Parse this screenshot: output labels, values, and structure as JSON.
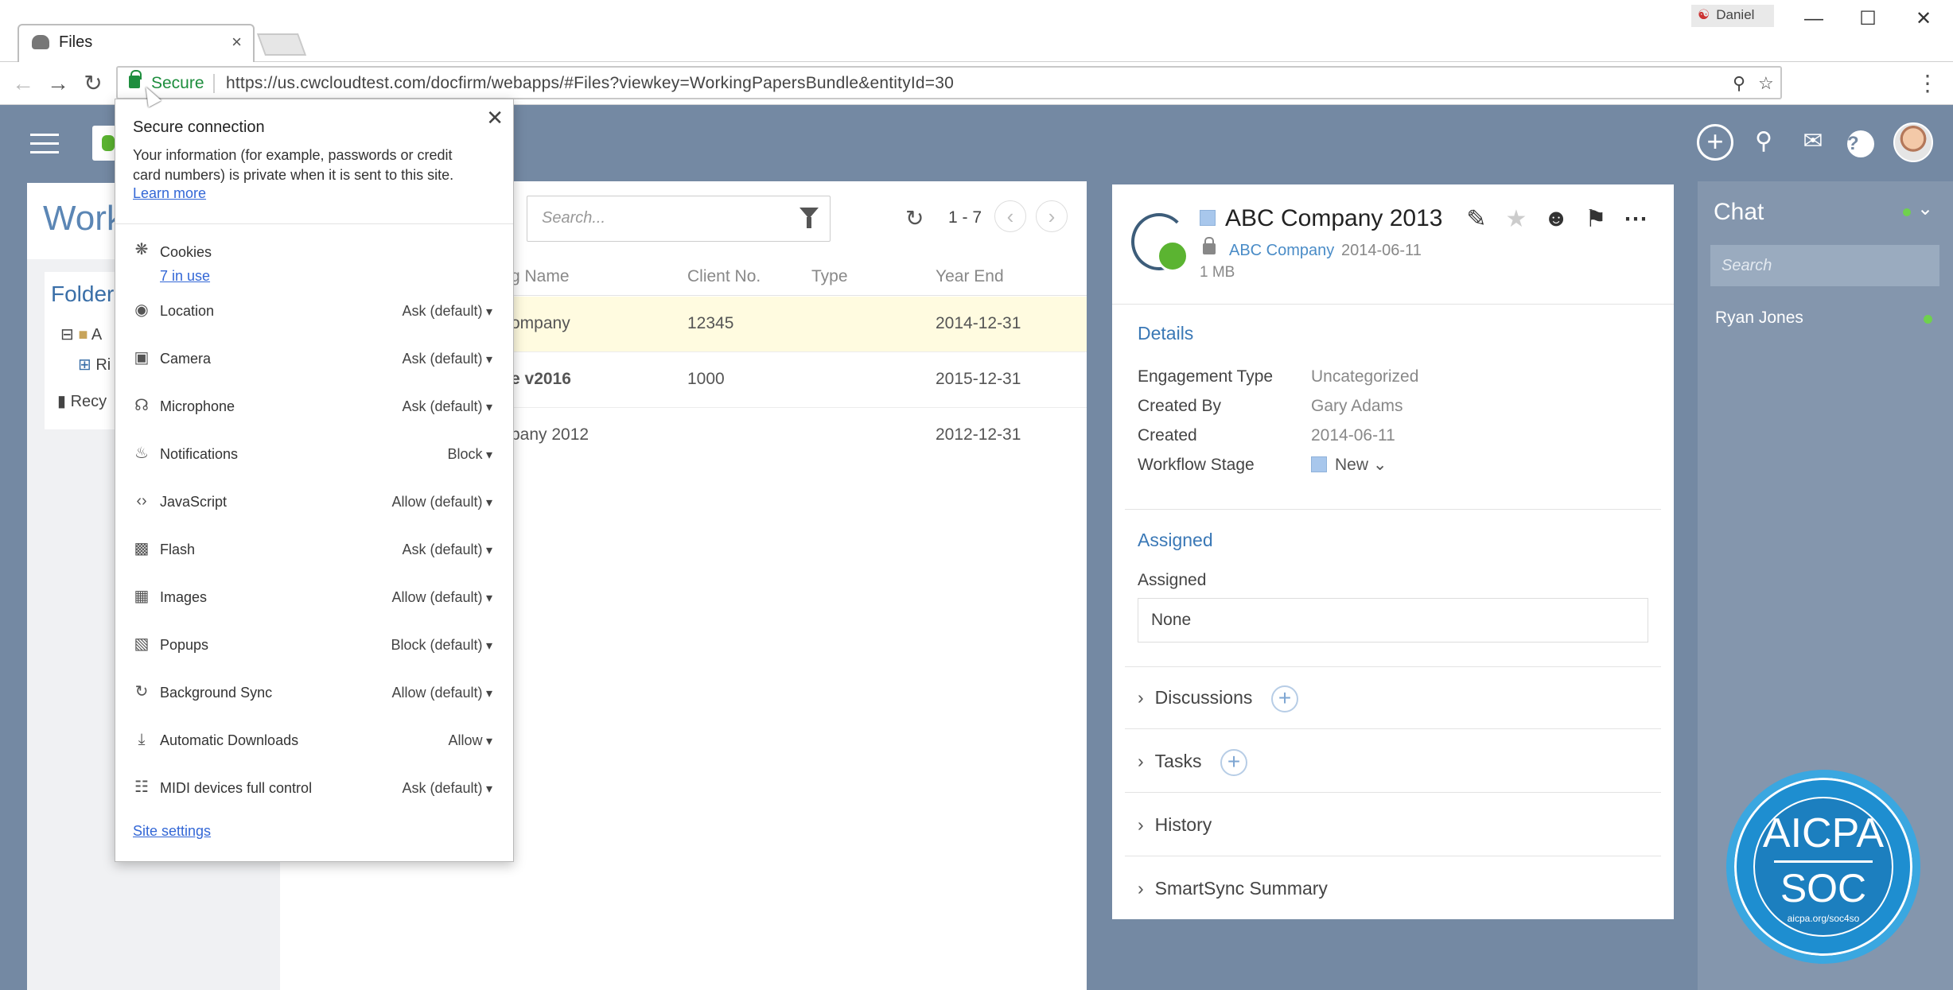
{
  "browser": {
    "tab_title": "Files",
    "tab_close": "×",
    "profile_name": "Daniel",
    "secure_label": "Secure",
    "url": "https://us.cwcloudtest.com/docfirm/webapps/#Files?viewkey=WorkingPapersBundle&entityId=30"
  },
  "site_info": {
    "heading": "Secure connection",
    "description": "Your information (for example, passwords or credit card numbers) is private when it is sent to this site.",
    "learn_more": "Learn more",
    "cookies_label": "Cookies",
    "cookies_in_use": "7 in use",
    "permissions": [
      {
        "label": "Location",
        "value": "Ask (default)",
        "icon": "location-icon"
      },
      {
        "label": "Camera",
        "value": "Ask (default)",
        "icon": "camera-icon"
      },
      {
        "label": "Microphone",
        "value": "Ask (default)",
        "icon": "microphone-icon"
      },
      {
        "label": "Notifications",
        "value": "Block",
        "icon": "notifications-icon"
      },
      {
        "label": "JavaScript",
        "value": "Allow (default)",
        "icon": "code-icon"
      },
      {
        "label": "Flash",
        "value": "Ask (default)",
        "icon": "puzzle-icon"
      },
      {
        "label": "Images",
        "value": "Allow (default)",
        "icon": "image-icon"
      },
      {
        "label": "Popups",
        "value": "Block (default)",
        "icon": "popup-icon"
      },
      {
        "label": "Background Sync",
        "value": "Allow (default)",
        "icon": "sync-icon"
      },
      {
        "label": "Automatic Downloads",
        "value": "Allow",
        "icon": "download-icon"
      },
      {
        "label": "MIDI devices full control",
        "value": "Ask (default)",
        "icon": "piano-icon"
      }
    ],
    "site_settings": "Site settings"
  },
  "left_panel": {
    "title": "Work",
    "folders_title": "Folder",
    "folder_items": [
      "A",
      "Ri",
      "Recy"
    ]
  },
  "files": {
    "search_placeholder": "Search...",
    "page_range": "1 - 7",
    "columns": [
      "g Name",
      "Client No.",
      "Type",
      "Year End"
    ],
    "rows": [
      {
        "name": "ompany",
        "client_no": "12345",
        "type": "",
        "year_end": "2014-12-31"
      },
      {
        "name": "e v2016",
        "client_no": "1000",
        "type": "",
        "year_end": "2015-12-31"
      },
      {
        "name": "pany 2012",
        "client_no": "",
        "type": "",
        "year_end": "2012-12-31"
      }
    ]
  },
  "detail": {
    "title": "ABC Company 2013",
    "client": "ABC Company",
    "date": "2014-06-11",
    "size": "1 MB",
    "details_heading": "Details",
    "fields": [
      {
        "key": "Engagement Type",
        "value": "Uncategorized"
      },
      {
        "key": "Created By",
        "value": "Gary Adams"
      },
      {
        "key": "Created",
        "value": "2014-06-11"
      },
      {
        "key": "Workflow Stage",
        "value": ""
      }
    ],
    "workflow_stage": "New",
    "assigned_heading": "Assigned",
    "assigned_label": "Assigned",
    "assigned_value": "None",
    "sections": [
      "Discussions",
      "Tasks",
      "History",
      "SmartSync Summary"
    ]
  },
  "chat": {
    "title": "Chat",
    "search_placeholder": "Search",
    "users": [
      "Ryan Jones"
    ]
  },
  "seal": {
    "line1": "AICPA",
    "line2": "SOC",
    "url": "aicpa.org/soc4so"
  },
  "colors": {
    "header": "#7489a3",
    "accent": "#3a78b6",
    "secure_green": "#1e8e3e",
    "selected_row": "#fffbe0"
  }
}
